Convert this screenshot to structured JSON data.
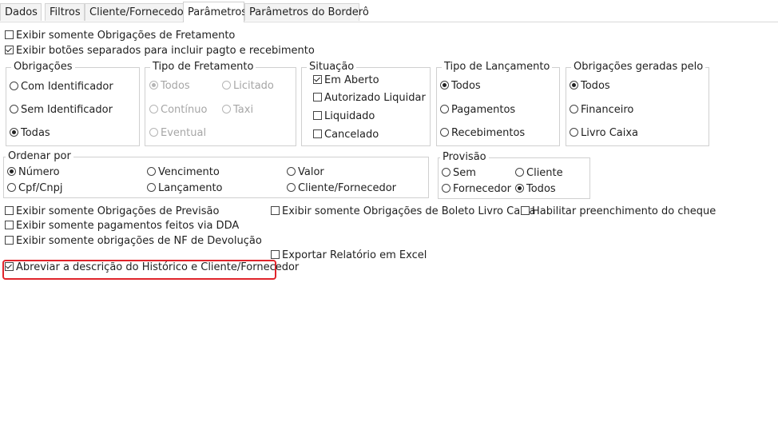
{
  "tabs": [
    "Dados",
    "Filtros",
    "Cliente/Fornecedor",
    "Parâmetros",
    "Parâmetros do Borderô"
  ],
  "active_tab": "Parâmetros",
  "top_options": {
    "fretamento": "Exibir somente Obrigações de Fretamento",
    "botoes": "Exibir botões separados para incluir pagto e recebimento"
  },
  "obrigacoes": {
    "title": "Obrigações",
    "items": [
      "Com Identificador",
      "Sem Identificador",
      "Todas"
    ],
    "selected": "Todas"
  },
  "tipo_fretamento": {
    "title": "Tipo de Fretamento",
    "items": [
      "Todos",
      "Licitado",
      "Contínuo",
      "Taxi",
      "Eventual"
    ],
    "selected": "Todos"
  },
  "situacao": {
    "title": "Situação",
    "items": [
      "Em  Aberto",
      "Autorizado Liquidar",
      "Liquidado",
      "Cancelado"
    ],
    "checked": [
      "Em  Aberto"
    ]
  },
  "tipo_lancamento": {
    "title": "Tipo de Lançamento",
    "items": [
      "Todos",
      "Pagamentos",
      "Recebimentos"
    ],
    "selected": "Todos"
  },
  "obrigacoes_geradas": {
    "title": "Obrigações geradas pelo",
    "items": [
      "Todos",
      "Financeiro",
      "Livro Caixa"
    ],
    "selected": "Todos"
  },
  "ordenar_por": {
    "title": "Ordenar por",
    "items": [
      "Número",
      "Vencimento",
      "Valor",
      "Cpf/Cnpj",
      "Lançamento",
      "Cliente/Fornecedor"
    ],
    "selected": "Número"
  },
  "provisao": {
    "title": "Provisão",
    "items": [
      "Sem",
      "Cliente",
      "Fornecedor",
      "Todos"
    ],
    "selected": "Todos"
  },
  "bottom_options": {
    "previsao": "Exibir somente Obrigações de Previsão",
    "dda": "Exibir somente pagamentos feitos via DDA",
    "nf_devolucao": "Exibir somente obrigações de NF de Devolução",
    "boleto_livro_caixa": "Exibir somente Obrigações de Boleto Livro Caixa",
    "cheque": "Habilitar preenchimento do cheque",
    "excel": "Exportar Relatório em Excel",
    "abreviar": "Abreviar a descrição do Histórico e Cliente/Fornecedor"
  },
  "highlight_color": "#e0242b"
}
